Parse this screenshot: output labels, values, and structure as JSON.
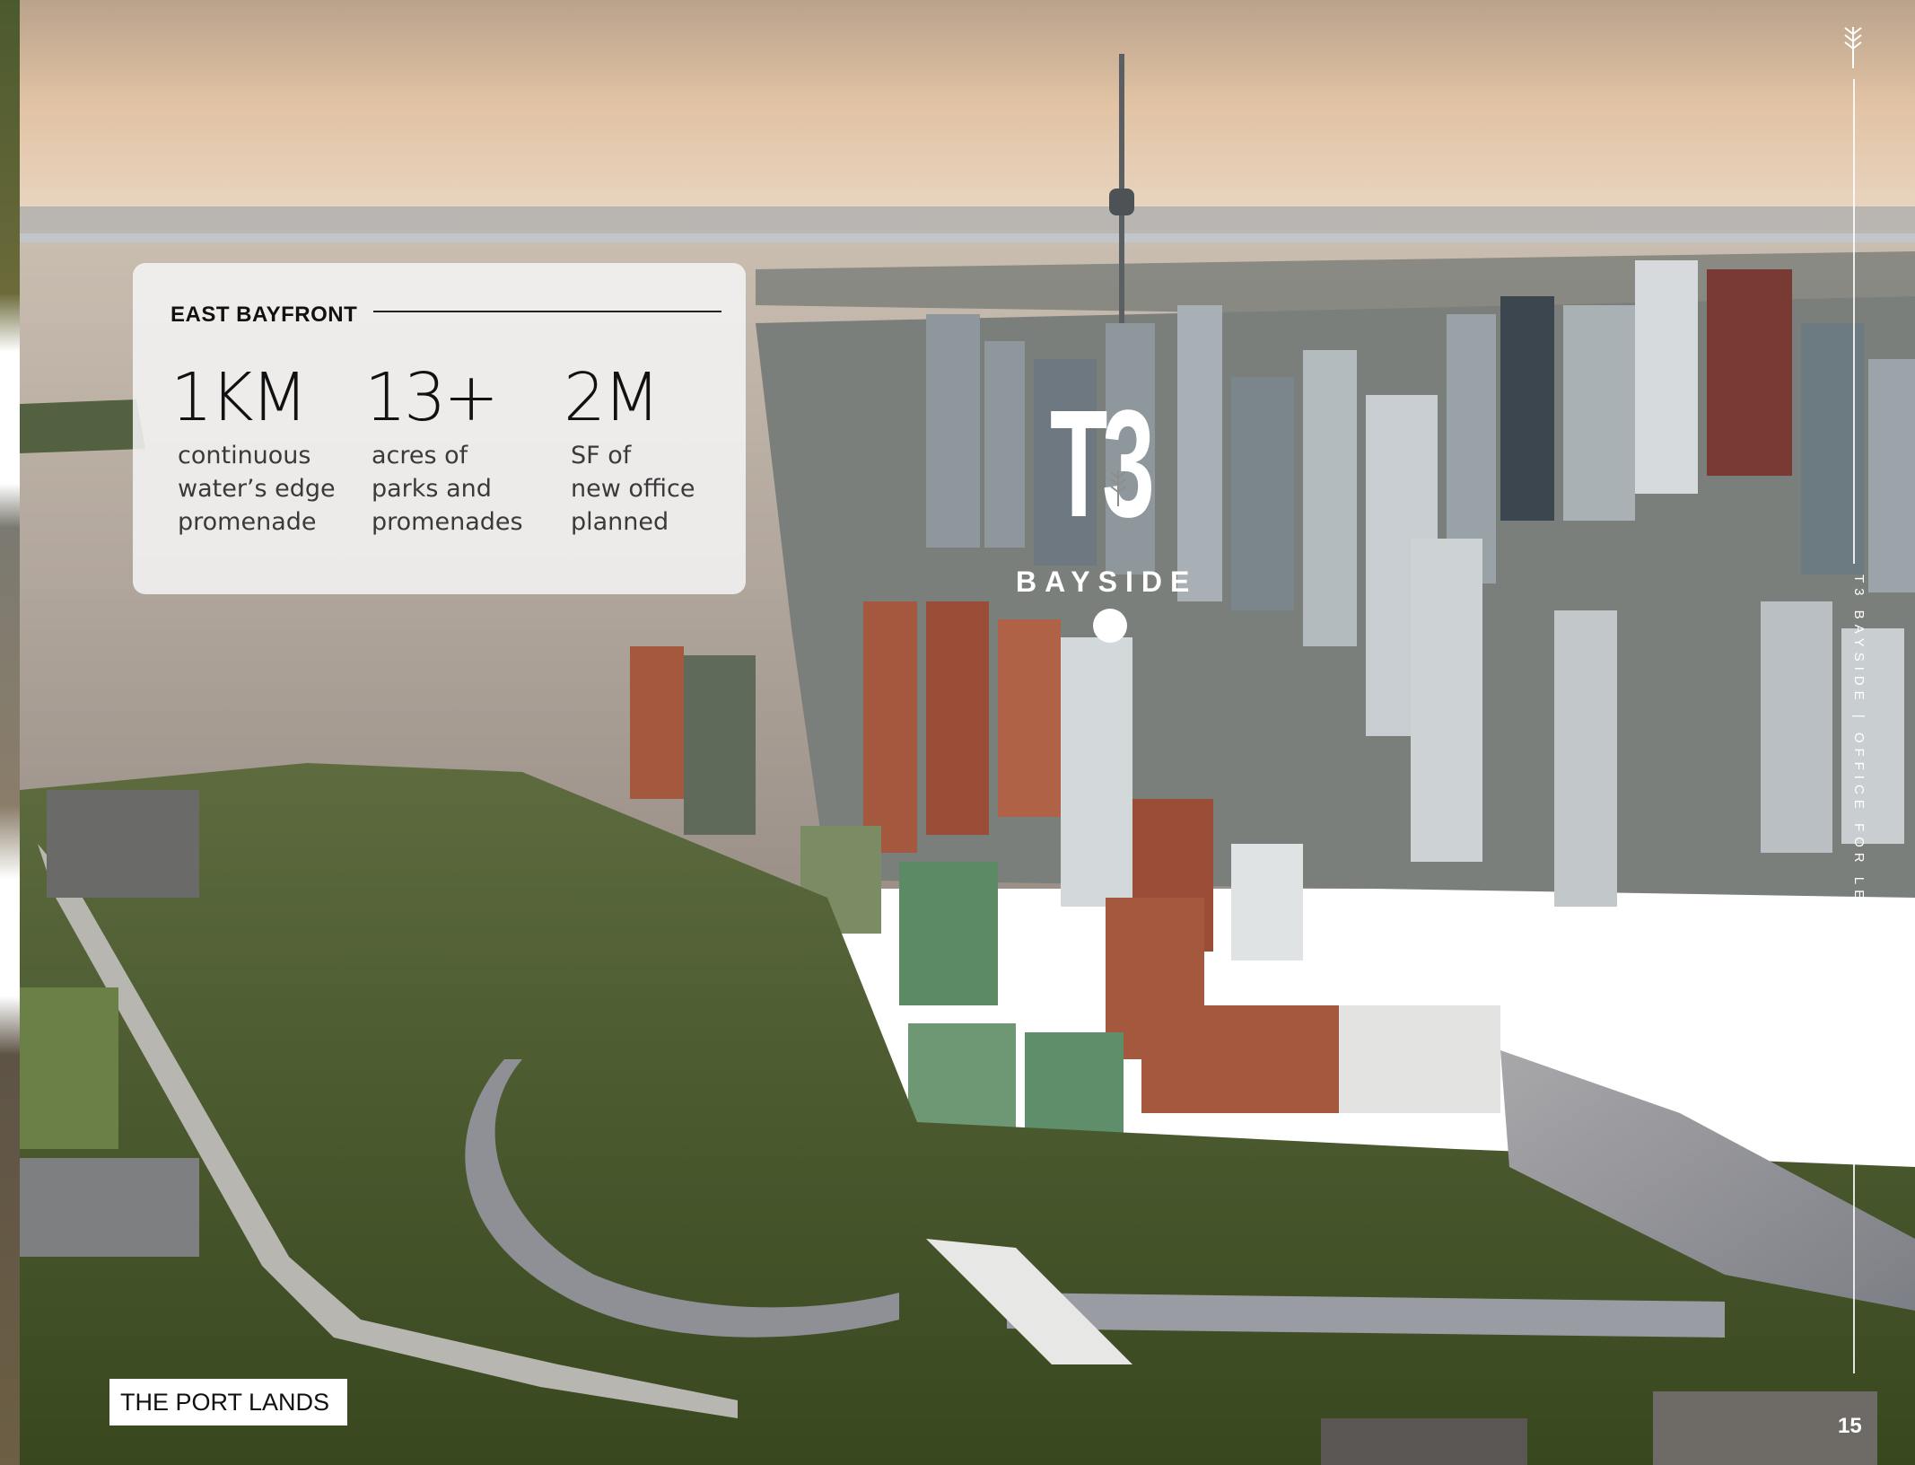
{
  "stats_card": {
    "heading": "EAST BAYFRONT",
    "stats": [
      {
        "value": "1KM",
        "label_lines": [
          "continuous",
          "water’s edge",
          "promenade"
        ]
      },
      {
        "value": "13+",
        "label_lines": [
          "acres of",
          "parks and",
          "promenades"
        ]
      },
      {
        "value": "2M",
        "label_lines": [
          "SF of",
          "new office",
          "planned"
        ]
      }
    ]
  },
  "logo": {
    "mark": "T3",
    "name": "BAYSIDE"
  },
  "side_rail": {
    "icon": "tree-icon",
    "text": "T3 BAYSIDE  |  OFFICE FOR LEASE"
  },
  "page_number": "15",
  "location_tag": "THE PORT LANDS",
  "colors": {
    "card_background": "#f4f4f4",
    "text_dark": "#111111",
    "logo_white": "#ffffff",
    "sky": "#d8b89a",
    "lake": "#b9aea2"
  }
}
